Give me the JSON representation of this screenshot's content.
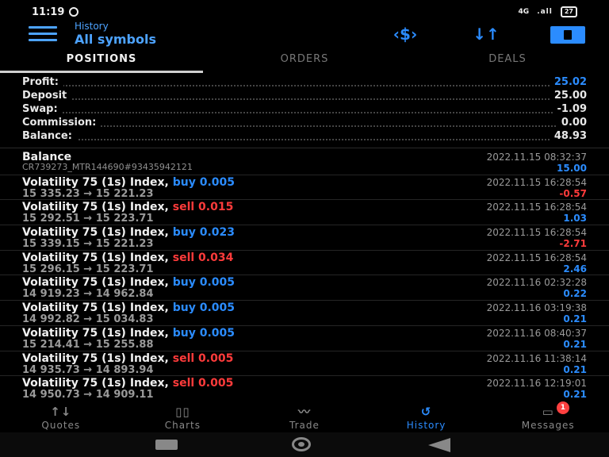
{
  "status_bar": {
    "time": "11:19",
    "network": "4G",
    "signal": ".all",
    "battery": "27"
  },
  "header": {
    "subtitle": "History",
    "title": "All symbols",
    "icons": [
      "menu-icon",
      "currency-exchange-icon",
      "sort-icon",
      "calendar-icon"
    ]
  },
  "tabs": [
    {
      "label": "POSITIONS",
      "active": true
    },
    {
      "label": "ORDERS",
      "active": false
    },
    {
      "label": "DEALS",
      "active": false
    }
  ],
  "summary": [
    {
      "label": "Profit:",
      "value": "25.02"
    },
    {
      "label": "Deposit",
      "value": "25.00"
    },
    {
      "label": "Swap:",
      "value": "-1.09"
    },
    {
      "label": "Commission:",
      "value": "0.00"
    },
    {
      "label": "Balance:",
      "value": "48.93"
    }
  ],
  "balance_entry": {
    "title": "Balance",
    "sub": "CR739273_MTR144690#93435942121",
    "time": "2022.11.15 08:32:37",
    "amount": "15.00"
  },
  "entries": [
    {
      "symbol": "Volatility 75 (1s) Index,",
      "side": "buy 0.005",
      "prices": "15 335.23  →  15 221.23",
      "time": "2022.11.15 16:28:54",
      "profit": "-0.57"
    },
    {
      "symbol": "Volatility 75 (1s) Index,",
      "side": "sell 0.015",
      "prices": "15 292.51  →  15 223.71",
      "time": "2022.11.15 16:28:54",
      "profit": "1.03"
    },
    {
      "symbol": "Volatility 75 (1s) Index,",
      "side": "buy 0.023",
      "prices": "15 339.15  →  15 221.23",
      "time": "2022.11.15 16:28:54",
      "profit": "-2.71"
    },
    {
      "symbol": "Volatility 75 (1s) Index,",
      "side": "sell 0.034",
      "prices": "15 296.15  →  15 223.71",
      "time": "2022.11.15 16:28:54",
      "profit": "2.46"
    },
    {
      "symbol": "Volatility 75 (1s) Index,",
      "side": "buy 0.005",
      "prices": "14 919.23  →  14 962.84",
      "time": "2022.11.16 02:32:28",
      "profit": "0.22"
    },
    {
      "symbol": "Volatility 75 (1s) Index,",
      "side": "buy 0.005",
      "prices": "14 992.82  →  15 034.83",
      "time": "2022.11.16 03:19:38",
      "profit": "0.21"
    },
    {
      "symbol": "Volatility 75 (1s) Index,",
      "side": "buy 0.005",
      "prices": "15 214.41  →  15 255.88",
      "time": "2022.11.16 08:40:37",
      "profit": "0.21"
    },
    {
      "symbol": "Volatility 75 (1s) Index,",
      "side": "sell 0.005",
      "prices": "14 935.73  →  14 893.94",
      "time": "2022.11.16 11:38:14",
      "profit": "0.21"
    },
    {
      "symbol": "Volatility 75 (1s) Index,",
      "side": "sell 0.005",
      "prices": "14 950.73  →  14 909.11",
      "time": "2022.11.16 12:19:01",
      "profit": "0.21"
    }
  ],
  "bottom_nav": [
    {
      "label": "Quotes",
      "icon": "quotes-icon",
      "glyph": "↑↓"
    },
    {
      "label": "Charts",
      "icon": "charts-icon",
      "glyph": "▯▯"
    },
    {
      "label": "Trade",
      "icon": "trade-icon",
      "glyph": "〰"
    },
    {
      "label": "History",
      "icon": "history-icon",
      "glyph": "↺",
      "active": true
    },
    {
      "label": "Messages",
      "icon": "messages-icon",
      "glyph": "▭",
      "badge": "1"
    }
  ],
  "colors": {
    "accent": "#2b8cff",
    "sell": "#ff3b3b",
    "background": "#000000"
  }
}
